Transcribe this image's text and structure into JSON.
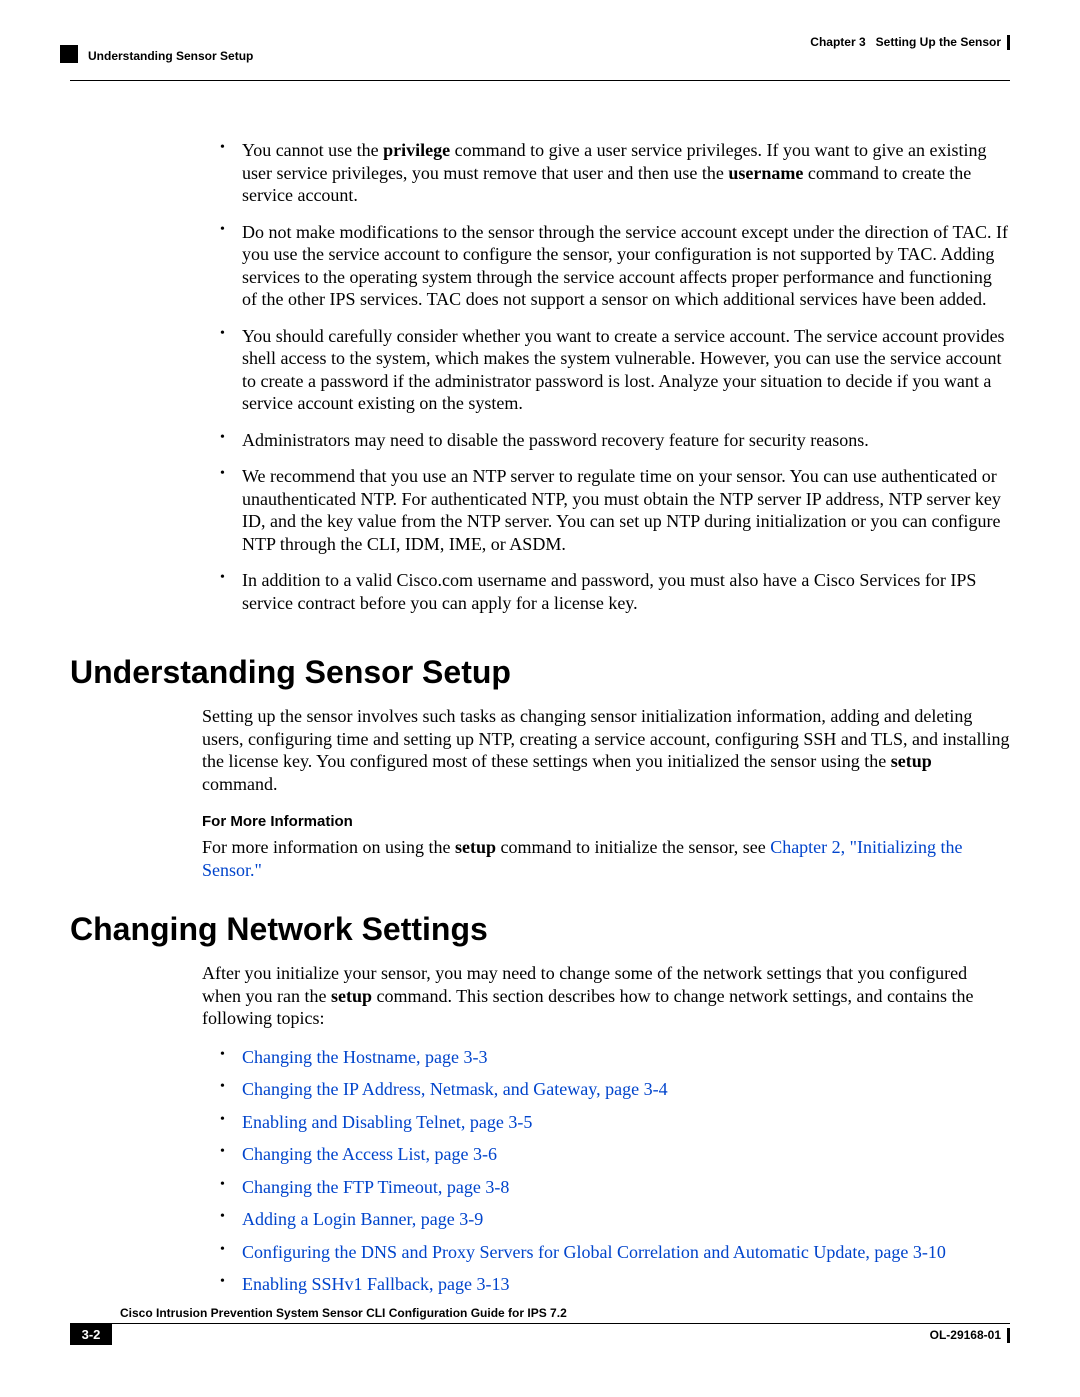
{
  "header": {
    "left": "Understanding Sensor Setup",
    "right_chapter": "Chapter 3",
    "right_title": "Setting Up the Sensor"
  },
  "bullets_top": {
    "b1a": "You cannot use the ",
    "b1b": "privilege",
    "b1c": " command to give a user service privileges. If you want to give an existing user service privileges, you must remove that user and then use the ",
    "b1d": "username",
    "b1e": " command to create the service account.",
    "b2": "Do not make modifications to the sensor through the service account except under the direction of TAC. If you use the service account to configure the sensor, your configuration is not supported by TAC. Adding services to the operating system through the service account affects proper performance and functioning of the other IPS services. TAC does not support a sensor on which additional services have been added.",
    "b3": "You should carefully consider whether you want to create a service account. The service account provides shell access to the system, which makes the system vulnerable. However, you can use the service account to create a password if the administrator password is lost. Analyze your situation to decide if you want a service account existing on the system.",
    "b4": "Administrators may need to disable the password recovery feature for security reasons.",
    "b5": "We recommend that you use an NTP server to regulate time on your sensor. You can use authenticated or unauthenticated NTP. For authenticated NTP, you must obtain the NTP server IP address, NTP server key ID, and the key value from the NTP server. You can set up NTP during initialization or you can configure NTP through the CLI, IDM, IME, or ASDM.",
    "b6": "In addition to a valid Cisco.com username and password, you must also have a Cisco Services for IPS service contract before you can apply for a license key."
  },
  "section1": {
    "title": "Understanding Sensor Setup",
    "para_a": "Setting up the sensor involves such tasks as changing sensor initialization information, adding and deleting users, configuring time and setting up NTP, creating a service account, configuring SSH and TLS, and installing the license key. You configured most of these settings when you initialized the sensor using the ",
    "para_b": "setup",
    "para_c": " command.",
    "subhead": "For More Information",
    "more_a": "For more information on using the ",
    "more_b": "setup",
    "more_c": " command to initialize the sensor, see ",
    "more_link": "Chapter 2, \"Initializing the Sensor.\""
  },
  "section2": {
    "title": "Changing Network Settings",
    "para_a": "After you initialize your sensor, you may need to change some of the network settings that you configured when you ran the ",
    "para_b": "setup",
    "para_c": " command. This section describes how to change network settings, and contains the following topics:",
    "links": {
      "l1": "Changing the Hostname, page 3-3",
      "l2": "Changing the IP Address, Netmask, and Gateway, page 3-4",
      "l3": "Enabling and Disabling Telnet, page 3-5",
      "l4": "Changing the Access List, page 3-6",
      "l5": "Changing the FTP Timeout, page 3-8",
      "l6": "Adding a Login Banner, page 3-9",
      "l7": "Configuring the DNS and Proxy Servers for Global Correlation and Automatic Update, page 3-10",
      "l8": "Enabling SSHv1 Fallback, page 3-13"
    }
  },
  "footer": {
    "title": "Cisco Intrusion Prevention System Sensor CLI Configuration Guide for IPS 7.2",
    "page": "3-2",
    "docnum": "OL-29168-01"
  }
}
